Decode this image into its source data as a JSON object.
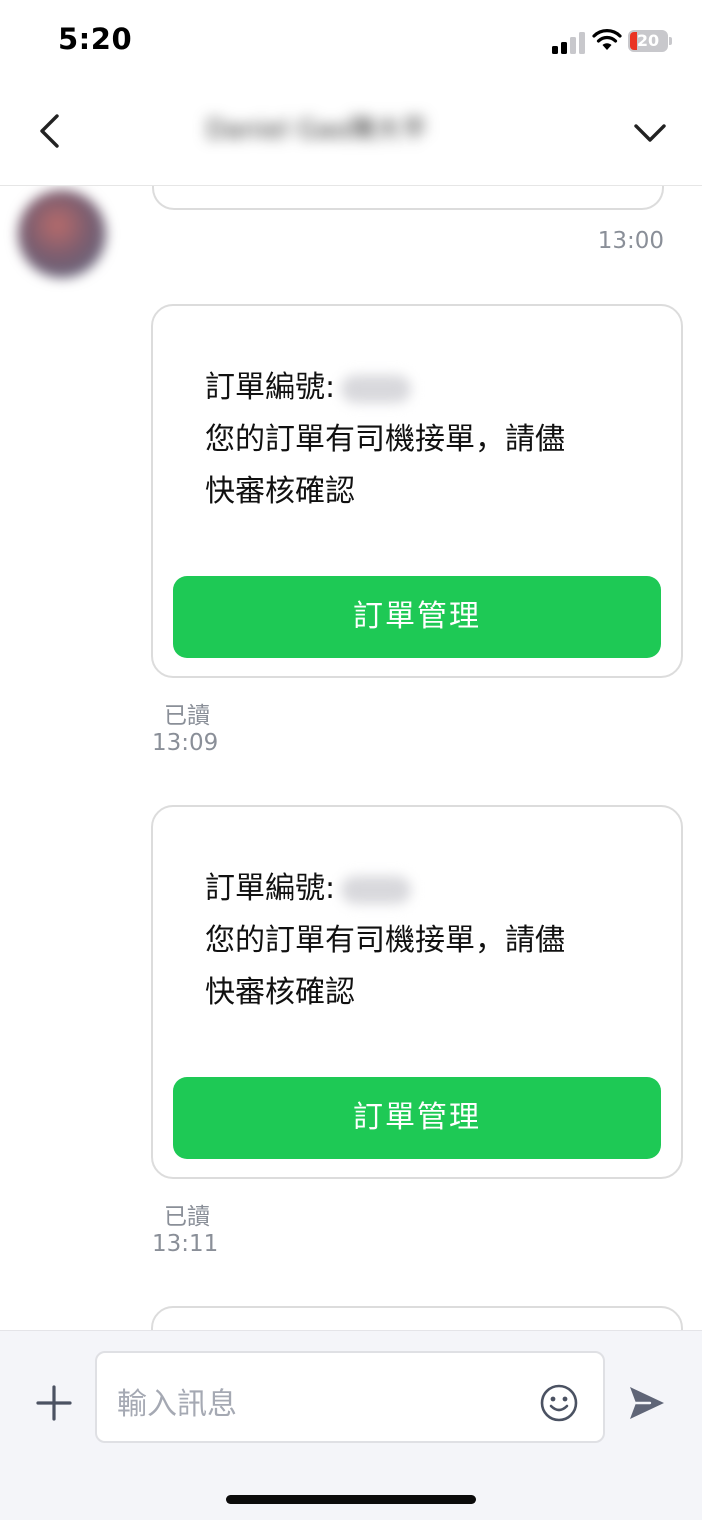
{
  "status_bar": {
    "time": "5:20",
    "battery": "20",
    "battery_level": 0.2,
    "battery_color": "#ea3323"
  },
  "header": {
    "title": "Daniel Gao陳大平",
    "back_icon": "chevron-left-icon",
    "expand_icon": "chevron-down-icon"
  },
  "chat": {
    "previous_message_time": "13:00",
    "messages": [
      {
        "order_label": "訂單編號:",
        "body_line1": "您的訂單有司機接單，請儘",
        "body_line2": "快審核確認",
        "button_label": "訂單管理",
        "read_status": "已讀",
        "time": "13:09"
      },
      {
        "order_label": "訂單編號:",
        "body_line1": "您的訂單有司機接單，請儘",
        "body_line2": "快審核確認",
        "button_label": "訂單管理",
        "read_status": "已讀",
        "time": "13:11"
      }
    ],
    "accent_color": "#1ec955"
  },
  "composer": {
    "placeholder": "輸入訊息",
    "plus_icon": "plus-icon",
    "emoji_icon": "smiley-icon",
    "send_icon": "send-icon"
  }
}
